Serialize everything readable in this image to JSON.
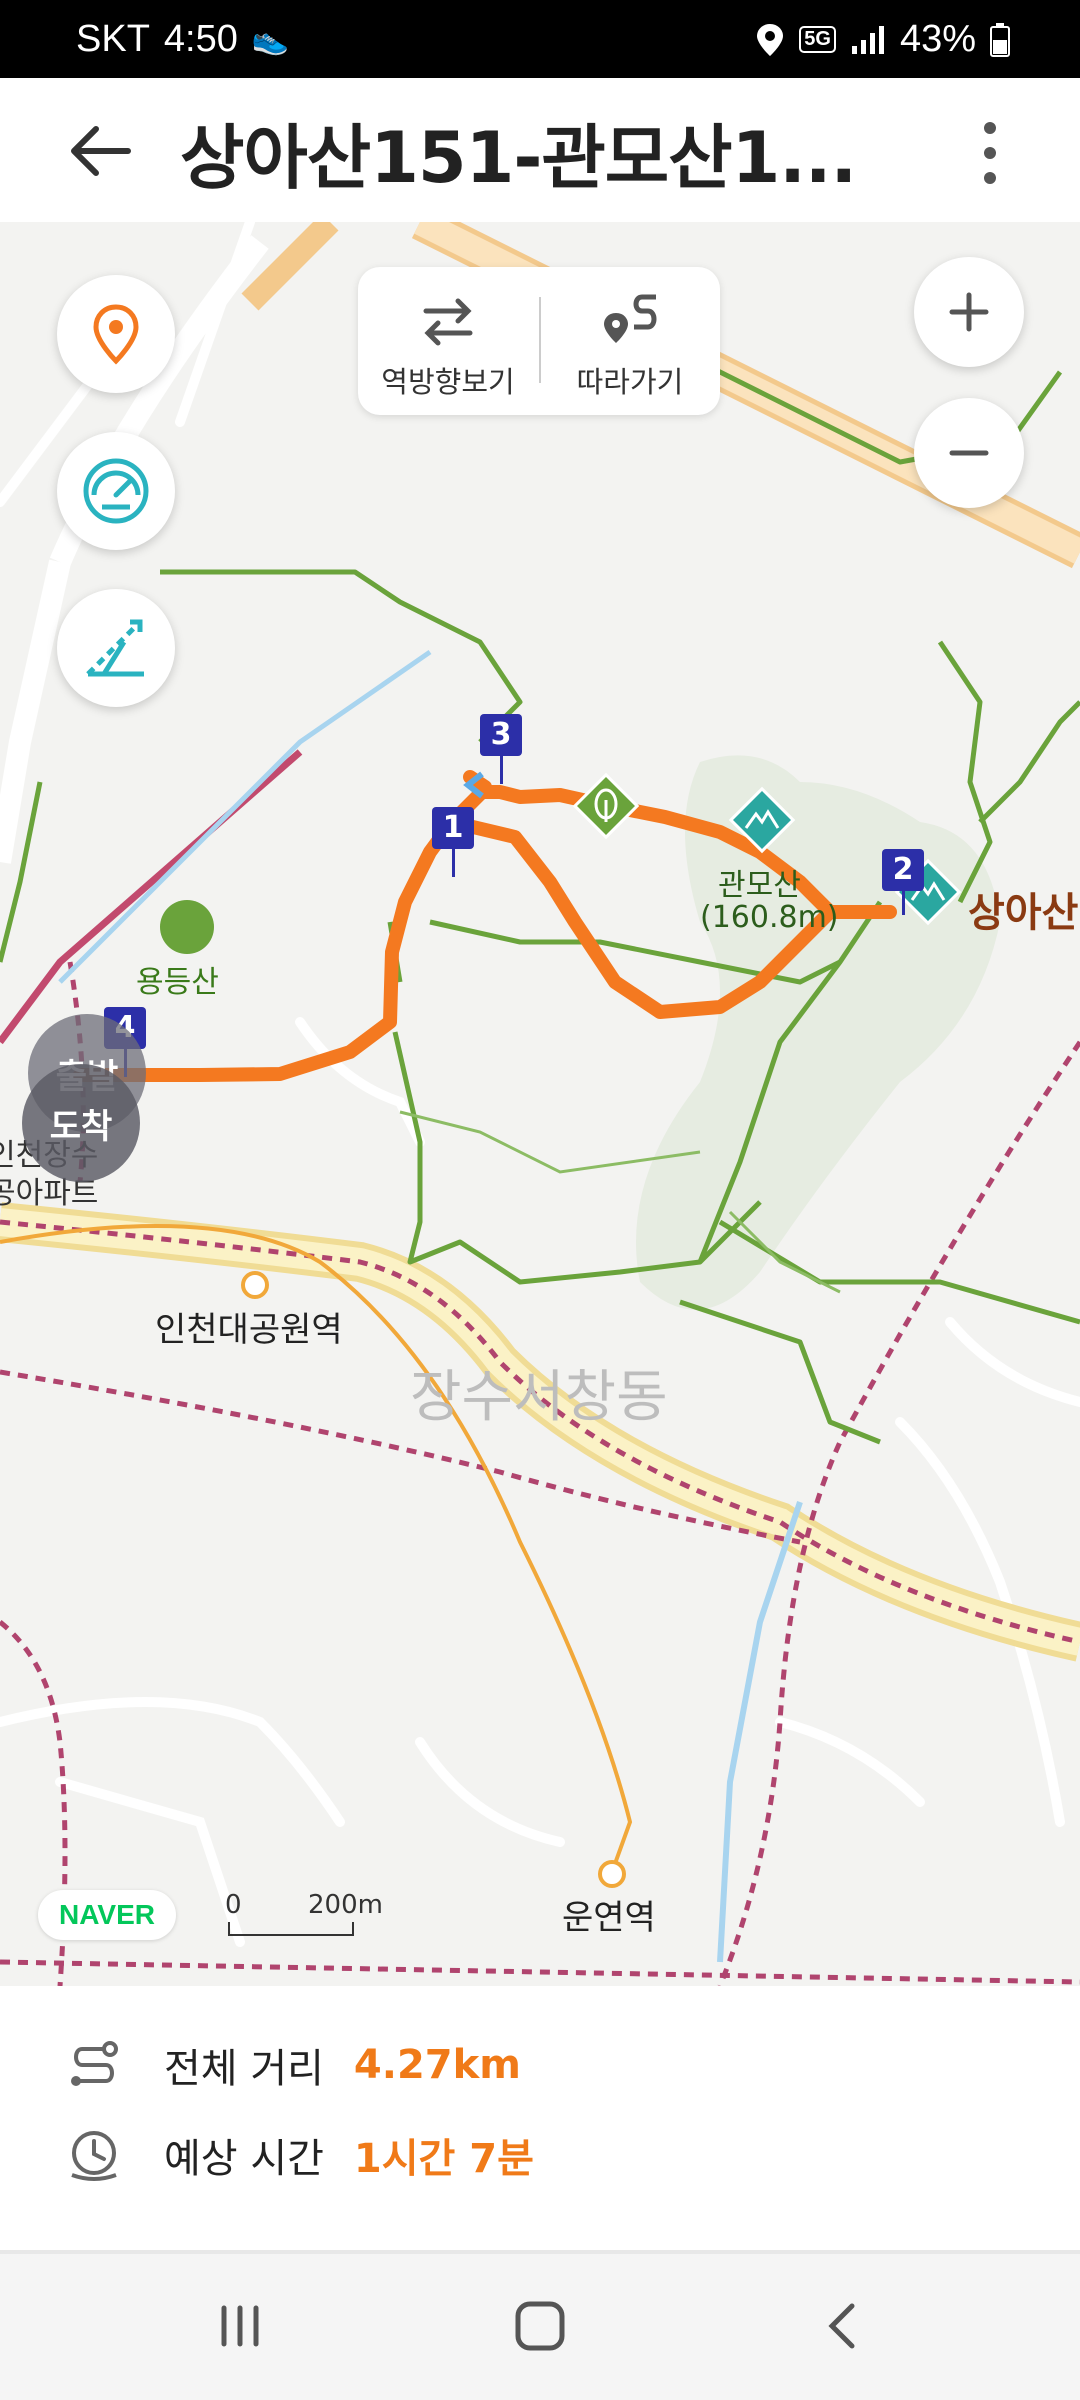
{
  "status_bar": {
    "carrier": "SKT",
    "time": "4:50",
    "network": "5G",
    "battery": "43%"
  },
  "app_bar": {
    "title": "상아산151-관모산1..."
  },
  "map": {
    "toolbox": {
      "reverse_label": "역방향보기",
      "follow_label": "따라가기"
    },
    "labels": {
      "yongdeungsan": "용등산",
      "gwanmosan": "관모산",
      "gwanmosan_elev": "(160.8m)",
      "sangasan": "상아산",
      "apartment_line1": "인천장수",
      "apartment_line2": "공아파트",
      "station_park": "인천대공원역",
      "district": "장수서창동",
      "station_unyeon": "운연역"
    },
    "waypoints": [
      "1",
      "2",
      "3",
      "4"
    ],
    "start_label": "출발",
    "end_label": "도착",
    "naver": "NAVER",
    "scale_zero": "0",
    "scale_value": "200m"
  },
  "info": {
    "distance_label": "전체 거리",
    "distance_value": "4.27km",
    "time_label": "예상 시간",
    "time_value": "1시간 7분"
  },
  "colors": {
    "route": "#f47920",
    "trail": "#6aa33b",
    "teal": "#2aa7a0",
    "marker": "#2c2fa8"
  }
}
